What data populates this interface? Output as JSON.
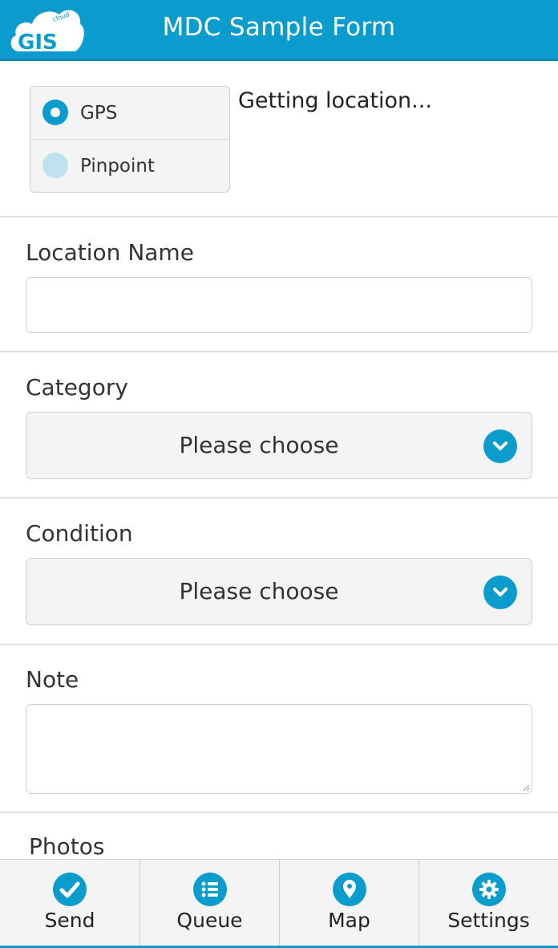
{
  "header": {
    "title": "MDC Sample Form",
    "logo_text": "GIS",
    "logo_small_text": "cloud"
  },
  "location": {
    "options": [
      {
        "label": "GPS",
        "selected": true
      },
      {
        "label": "Pinpoint",
        "selected": false
      }
    ],
    "status": "Getting location..."
  },
  "fields": {
    "location_name": {
      "label": "Location Name",
      "value": "",
      "placeholder": ""
    },
    "category": {
      "label": "Category",
      "selected": "Please choose"
    },
    "condition": {
      "label": "Condition",
      "selected": "Please choose"
    },
    "note": {
      "label": "Note",
      "value": "",
      "placeholder": ""
    },
    "photos": {
      "label": "Photos"
    }
  },
  "tabbar": {
    "items": [
      {
        "label": "Send",
        "icon": "checkmark-icon"
      },
      {
        "label": "Queue",
        "icon": "list-icon"
      },
      {
        "label": "Map",
        "icon": "map-pin-icon"
      },
      {
        "label": "Settings",
        "icon": "gear-icon"
      }
    ]
  },
  "colors": {
    "accent": "#0a9ccc",
    "radio_off": "#bfe3ee",
    "panel": "#f4f4f4"
  }
}
